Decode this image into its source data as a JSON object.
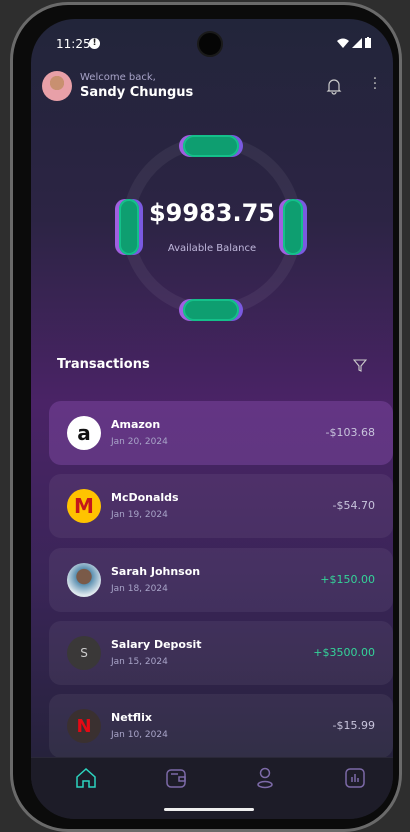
{
  "status": {
    "time": "11:25"
  },
  "header": {
    "welcome": "Welcome back,",
    "name": "Sandy Chungus"
  },
  "balance": {
    "amount": "$9983.75",
    "label": "Available Balance"
  },
  "transactions": {
    "title": "Transactions",
    "items": [
      {
        "name": "Amazon",
        "date": "Jan 20, 2024",
        "amount": "-$103.68",
        "type": "debit",
        "logo": "a"
      },
      {
        "name": "McDonalds",
        "date": "Jan 19, 2024",
        "amount": "-$54.70",
        "type": "debit",
        "logo": "M"
      },
      {
        "name": "Sarah Johnson",
        "date": "Jan 18, 2024",
        "amount": "+$150.00",
        "type": "credit",
        "logo": ""
      },
      {
        "name": "Salary Deposit",
        "date": "Jan 15, 2024",
        "amount": "+$3500.00",
        "type": "credit",
        "logo": "S"
      },
      {
        "name": "Netflix",
        "date": "Jan 10, 2024",
        "amount": "-$15.99",
        "type": "debit",
        "logo": "N"
      }
    ]
  },
  "nav": {
    "active": "home",
    "items": [
      "home",
      "wallet",
      "profile",
      "stats"
    ]
  },
  "colors": {
    "accent": "#2dd4bf",
    "credit": "#34d399",
    "ring": "#0e9e70"
  }
}
